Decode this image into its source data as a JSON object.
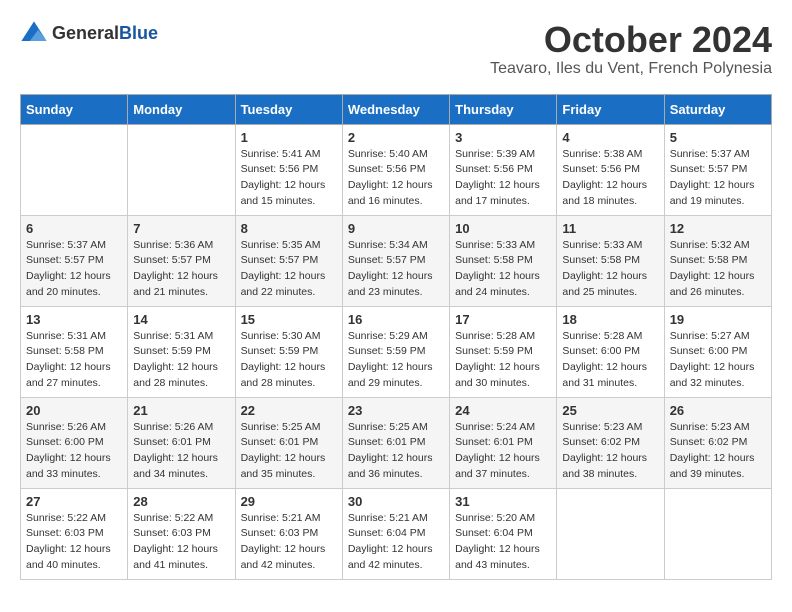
{
  "logo": {
    "general": "General",
    "blue": "Blue"
  },
  "title": {
    "month": "October 2024",
    "location": "Teavaro, Iles du Vent, French Polynesia"
  },
  "headers": [
    "Sunday",
    "Monday",
    "Tuesday",
    "Wednesday",
    "Thursday",
    "Friday",
    "Saturday"
  ],
  "weeks": [
    [
      {
        "day": "",
        "info": ""
      },
      {
        "day": "",
        "info": ""
      },
      {
        "day": "1",
        "info": "Sunrise: 5:41 AM\nSunset: 5:56 PM\nDaylight: 12 hours and 15 minutes."
      },
      {
        "day": "2",
        "info": "Sunrise: 5:40 AM\nSunset: 5:56 PM\nDaylight: 12 hours and 16 minutes."
      },
      {
        "day": "3",
        "info": "Sunrise: 5:39 AM\nSunset: 5:56 PM\nDaylight: 12 hours and 17 minutes."
      },
      {
        "day": "4",
        "info": "Sunrise: 5:38 AM\nSunset: 5:56 PM\nDaylight: 12 hours and 18 minutes."
      },
      {
        "day": "5",
        "info": "Sunrise: 5:37 AM\nSunset: 5:57 PM\nDaylight: 12 hours and 19 minutes."
      }
    ],
    [
      {
        "day": "6",
        "info": "Sunrise: 5:37 AM\nSunset: 5:57 PM\nDaylight: 12 hours and 20 minutes."
      },
      {
        "day": "7",
        "info": "Sunrise: 5:36 AM\nSunset: 5:57 PM\nDaylight: 12 hours and 21 minutes."
      },
      {
        "day": "8",
        "info": "Sunrise: 5:35 AM\nSunset: 5:57 PM\nDaylight: 12 hours and 22 minutes."
      },
      {
        "day": "9",
        "info": "Sunrise: 5:34 AM\nSunset: 5:57 PM\nDaylight: 12 hours and 23 minutes."
      },
      {
        "day": "10",
        "info": "Sunrise: 5:33 AM\nSunset: 5:58 PM\nDaylight: 12 hours and 24 minutes."
      },
      {
        "day": "11",
        "info": "Sunrise: 5:33 AM\nSunset: 5:58 PM\nDaylight: 12 hours and 25 minutes."
      },
      {
        "day": "12",
        "info": "Sunrise: 5:32 AM\nSunset: 5:58 PM\nDaylight: 12 hours and 26 minutes."
      }
    ],
    [
      {
        "day": "13",
        "info": "Sunrise: 5:31 AM\nSunset: 5:58 PM\nDaylight: 12 hours and 27 minutes."
      },
      {
        "day": "14",
        "info": "Sunrise: 5:31 AM\nSunset: 5:59 PM\nDaylight: 12 hours and 28 minutes."
      },
      {
        "day": "15",
        "info": "Sunrise: 5:30 AM\nSunset: 5:59 PM\nDaylight: 12 hours and 28 minutes."
      },
      {
        "day": "16",
        "info": "Sunrise: 5:29 AM\nSunset: 5:59 PM\nDaylight: 12 hours and 29 minutes."
      },
      {
        "day": "17",
        "info": "Sunrise: 5:28 AM\nSunset: 5:59 PM\nDaylight: 12 hours and 30 minutes."
      },
      {
        "day": "18",
        "info": "Sunrise: 5:28 AM\nSunset: 6:00 PM\nDaylight: 12 hours and 31 minutes."
      },
      {
        "day": "19",
        "info": "Sunrise: 5:27 AM\nSunset: 6:00 PM\nDaylight: 12 hours and 32 minutes."
      }
    ],
    [
      {
        "day": "20",
        "info": "Sunrise: 5:26 AM\nSunset: 6:00 PM\nDaylight: 12 hours and 33 minutes."
      },
      {
        "day": "21",
        "info": "Sunrise: 5:26 AM\nSunset: 6:01 PM\nDaylight: 12 hours and 34 minutes."
      },
      {
        "day": "22",
        "info": "Sunrise: 5:25 AM\nSunset: 6:01 PM\nDaylight: 12 hours and 35 minutes."
      },
      {
        "day": "23",
        "info": "Sunrise: 5:25 AM\nSunset: 6:01 PM\nDaylight: 12 hours and 36 minutes."
      },
      {
        "day": "24",
        "info": "Sunrise: 5:24 AM\nSunset: 6:01 PM\nDaylight: 12 hours and 37 minutes."
      },
      {
        "day": "25",
        "info": "Sunrise: 5:23 AM\nSunset: 6:02 PM\nDaylight: 12 hours and 38 minutes."
      },
      {
        "day": "26",
        "info": "Sunrise: 5:23 AM\nSunset: 6:02 PM\nDaylight: 12 hours and 39 minutes."
      }
    ],
    [
      {
        "day": "27",
        "info": "Sunrise: 5:22 AM\nSunset: 6:03 PM\nDaylight: 12 hours and 40 minutes."
      },
      {
        "day": "28",
        "info": "Sunrise: 5:22 AM\nSunset: 6:03 PM\nDaylight: 12 hours and 41 minutes."
      },
      {
        "day": "29",
        "info": "Sunrise: 5:21 AM\nSunset: 6:03 PM\nDaylight: 12 hours and 42 minutes."
      },
      {
        "day": "30",
        "info": "Sunrise: 5:21 AM\nSunset: 6:04 PM\nDaylight: 12 hours and 42 minutes."
      },
      {
        "day": "31",
        "info": "Sunrise: 5:20 AM\nSunset: 6:04 PM\nDaylight: 12 hours and 43 minutes."
      },
      {
        "day": "",
        "info": ""
      },
      {
        "day": "",
        "info": ""
      }
    ]
  ]
}
